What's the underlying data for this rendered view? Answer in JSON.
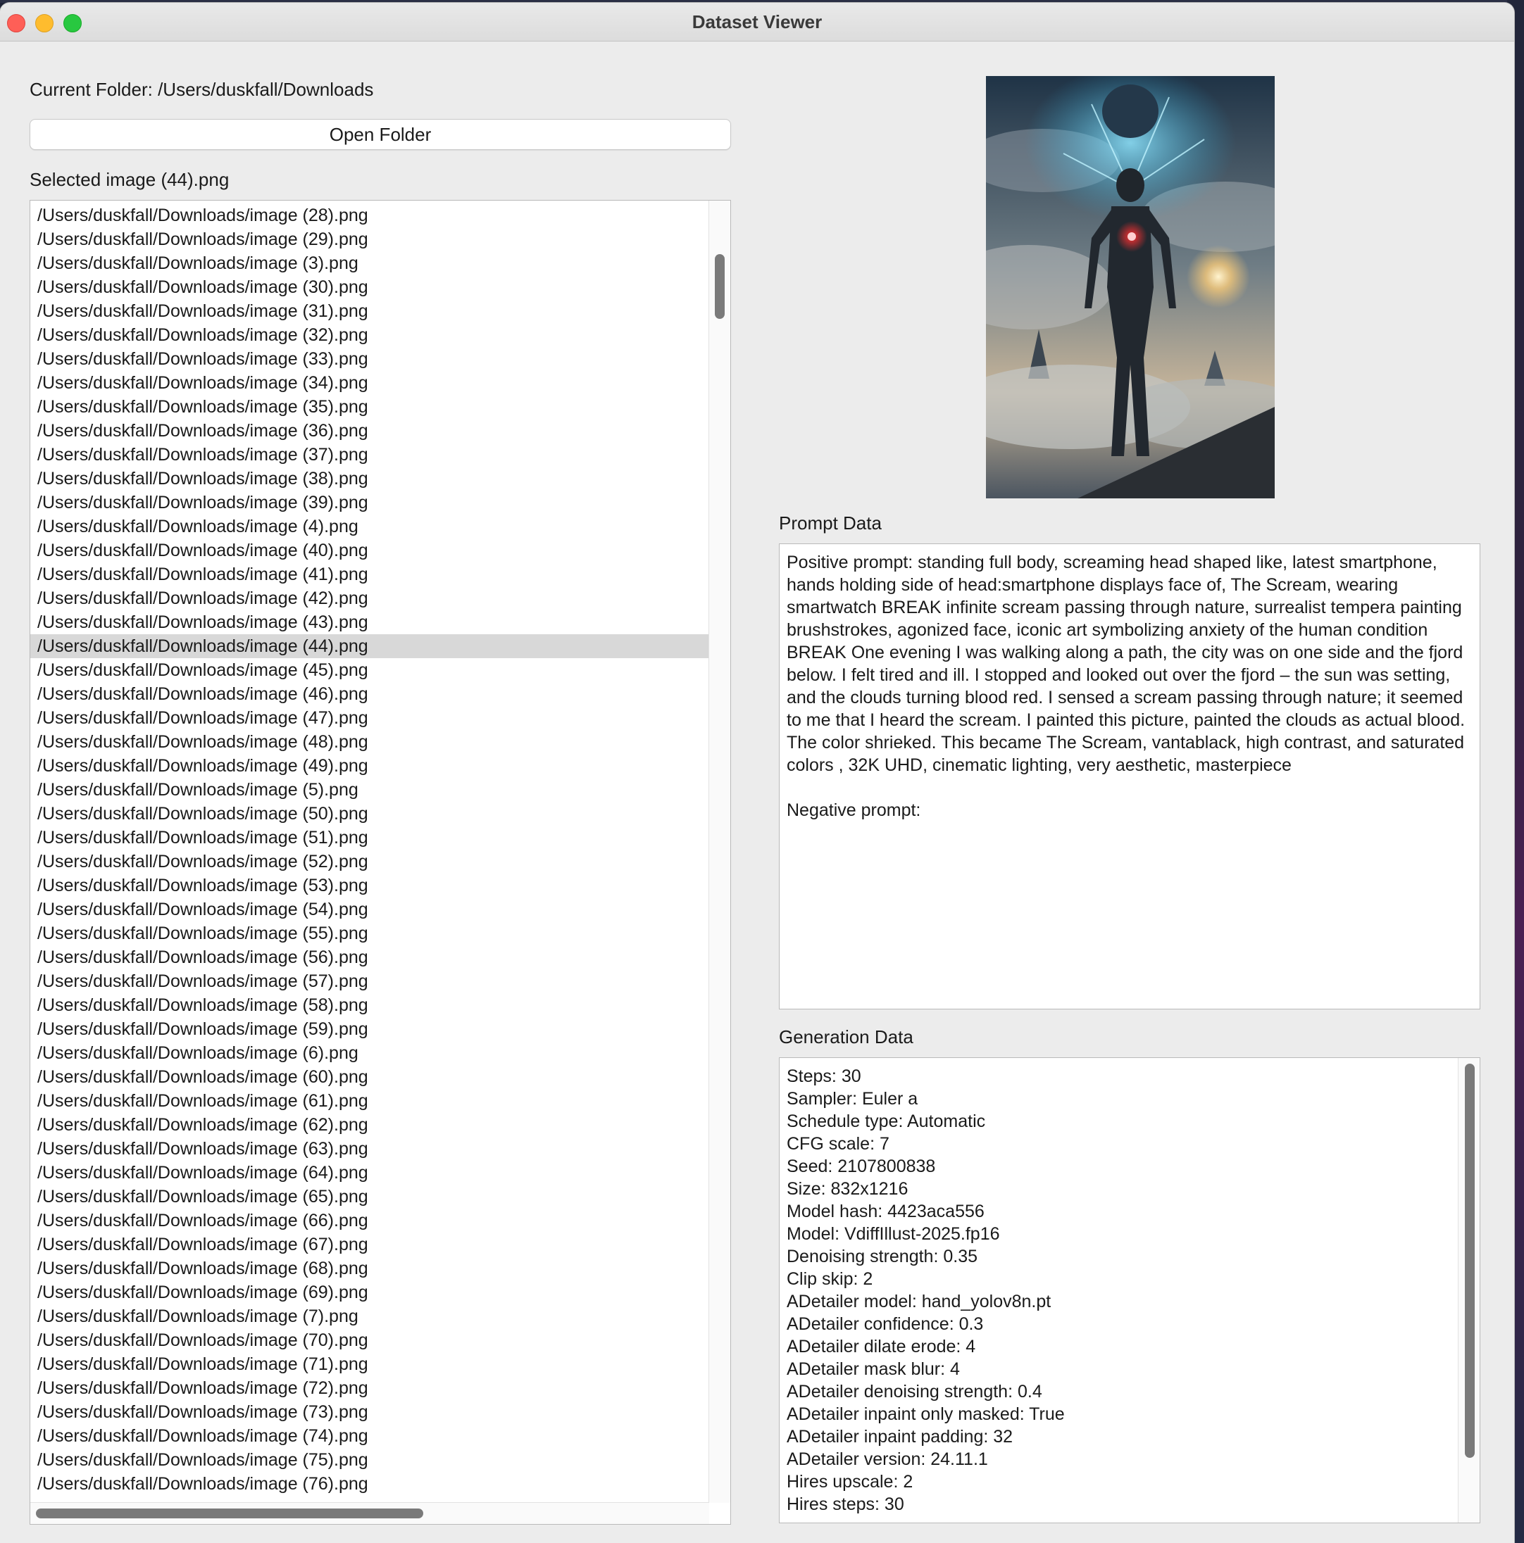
{
  "window": {
    "title": "Dataset Viewer"
  },
  "folder": {
    "current_label": "Current Folder: /Users/duskfall/Downloads",
    "open_button": "Open Folder",
    "selected_label": "Selected image (44).png"
  },
  "file_list": {
    "selected_index": 18,
    "items": [
      "/Users/duskfall/Downloads/image (28).png",
      "/Users/duskfall/Downloads/image (29).png",
      "/Users/duskfall/Downloads/image (3).png",
      "/Users/duskfall/Downloads/image (30).png",
      "/Users/duskfall/Downloads/image (31).png",
      "/Users/duskfall/Downloads/image (32).png",
      "/Users/duskfall/Downloads/image (33).png",
      "/Users/duskfall/Downloads/image (34).png",
      "/Users/duskfall/Downloads/image (35).png",
      "/Users/duskfall/Downloads/image (36).png",
      "/Users/duskfall/Downloads/image (37).png",
      "/Users/duskfall/Downloads/image (38).png",
      "/Users/duskfall/Downloads/image (39).png",
      "/Users/duskfall/Downloads/image (4).png",
      "/Users/duskfall/Downloads/image (40).png",
      "/Users/duskfall/Downloads/image (41).png",
      "/Users/duskfall/Downloads/image (42).png",
      "/Users/duskfall/Downloads/image (43).png",
      "/Users/duskfall/Downloads/image (44).png",
      "/Users/duskfall/Downloads/image (45).png",
      "/Users/duskfall/Downloads/image (46).png",
      "/Users/duskfall/Downloads/image (47).png",
      "/Users/duskfall/Downloads/image (48).png",
      "/Users/duskfall/Downloads/image (49).png",
      "/Users/duskfall/Downloads/image (5).png",
      "/Users/duskfall/Downloads/image (50).png",
      "/Users/duskfall/Downloads/image (51).png",
      "/Users/duskfall/Downloads/image (52).png",
      "/Users/duskfall/Downloads/image (53).png",
      "/Users/duskfall/Downloads/image (54).png",
      "/Users/duskfall/Downloads/image (55).png",
      "/Users/duskfall/Downloads/image (56).png",
      "/Users/duskfall/Downloads/image (57).png",
      "/Users/duskfall/Downloads/image (58).png",
      "/Users/duskfall/Downloads/image (59).png",
      "/Users/duskfall/Downloads/image (6).png",
      "/Users/duskfall/Downloads/image (60).png",
      "/Users/duskfall/Downloads/image (61).png",
      "/Users/duskfall/Downloads/image (62).png",
      "/Users/duskfall/Downloads/image (63).png",
      "/Users/duskfall/Downloads/image (64).png",
      "/Users/duskfall/Downloads/image (65).png",
      "/Users/duskfall/Downloads/image (66).png",
      "/Users/duskfall/Downloads/image (67).png",
      "/Users/duskfall/Downloads/image (68).png",
      "/Users/duskfall/Downloads/image (69).png",
      "/Users/duskfall/Downloads/image (7).png",
      "/Users/duskfall/Downloads/image (70).png",
      "/Users/duskfall/Downloads/image (71).png",
      "/Users/duskfall/Downloads/image (72).png",
      "/Users/duskfall/Downloads/image (73).png",
      "/Users/duskfall/Downloads/image (74).png",
      "/Users/duskfall/Downloads/image (75).png",
      "/Users/duskfall/Downloads/image (76).png"
    ]
  },
  "prompt_section": {
    "label": "Prompt Data",
    "text": "Positive prompt: standing full body, screaming head shaped like, latest smartphone, hands holding side of head:smartphone displays face of, The Scream, wearing smartwatch BREAK infinite scream passing through nature, surrealist tempera painting brushstrokes, agonized face, iconic art symbolizing anxiety of the human condition BREAK One evening I was walking along a path, the city was on one side and the fjord below. I felt tired and ill. I stopped and looked out over the fjord – the sun was setting, and the clouds turning blood red. I sensed a scream passing through nature; it seemed to me that I heard the scream. I painted this picture, painted the clouds as actual blood. The color shrieked. This became The Scream, vantablack, high contrast, and saturated colors , 32K UHD, cinematic lighting, very aesthetic, masterpiece\n\nNegative prompt:"
  },
  "generation_section": {
    "label": "Generation Data",
    "lines": [
      "Steps: 30",
      "Sampler: Euler a",
      "Schedule type: Automatic",
      "CFG scale: 7",
      "Seed: 2107800838",
      "Size: 832x1216",
      "Model hash: 4423aca556",
      "Model: VdiffIllust-2025.fp16",
      "Denoising strength: 0.35",
      "Clip skip: 2",
      "ADetailer model: hand_yolov8n.pt",
      "ADetailer confidence: 0.3",
      "ADetailer dilate erode: 4",
      "ADetailer mask blur: 4",
      "ADetailer denoising strength: 0.4",
      "ADetailer inpaint only masked: True",
      "ADetailer inpaint padding: 32",
      "ADetailer version: 24.11.1",
      "Hires upscale: 2",
      "Hires steps: 30"
    ]
  },
  "colors": {
    "window_bg": "#ececec",
    "selection": "#d8d8d8",
    "close": "#fe5f57",
    "minimize": "#febc2e",
    "maximize": "#28c840"
  },
  "icons": [
    "close-button",
    "minimize-button",
    "maximize-button"
  ]
}
